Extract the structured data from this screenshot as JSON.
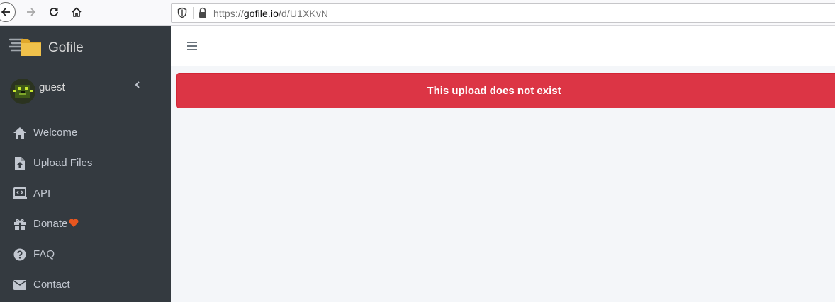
{
  "browser": {
    "url_prefix": "https://",
    "url_host": "gofile.io",
    "url_path": "/d/U1XKvN"
  },
  "sidebar": {
    "brand_name": "Gofile",
    "user_name": "guest",
    "items": [
      {
        "label": "Welcome",
        "icon": "home-icon"
      },
      {
        "label": "Upload Files",
        "icon": "file-upload-icon"
      },
      {
        "label": "API",
        "icon": "laptop-code-icon"
      },
      {
        "label": "Donate",
        "icon": "gift-icon"
      },
      {
        "label": "FAQ",
        "icon": "question-circle-icon"
      },
      {
        "label": "Contact",
        "icon": "envelope-icon"
      }
    ]
  },
  "alert": {
    "message": "This upload does not exist"
  },
  "colors": {
    "sidebar_bg": "#343a40",
    "alert_bg": "#dc3545",
    "heart": "#e8561f"
  }
}
